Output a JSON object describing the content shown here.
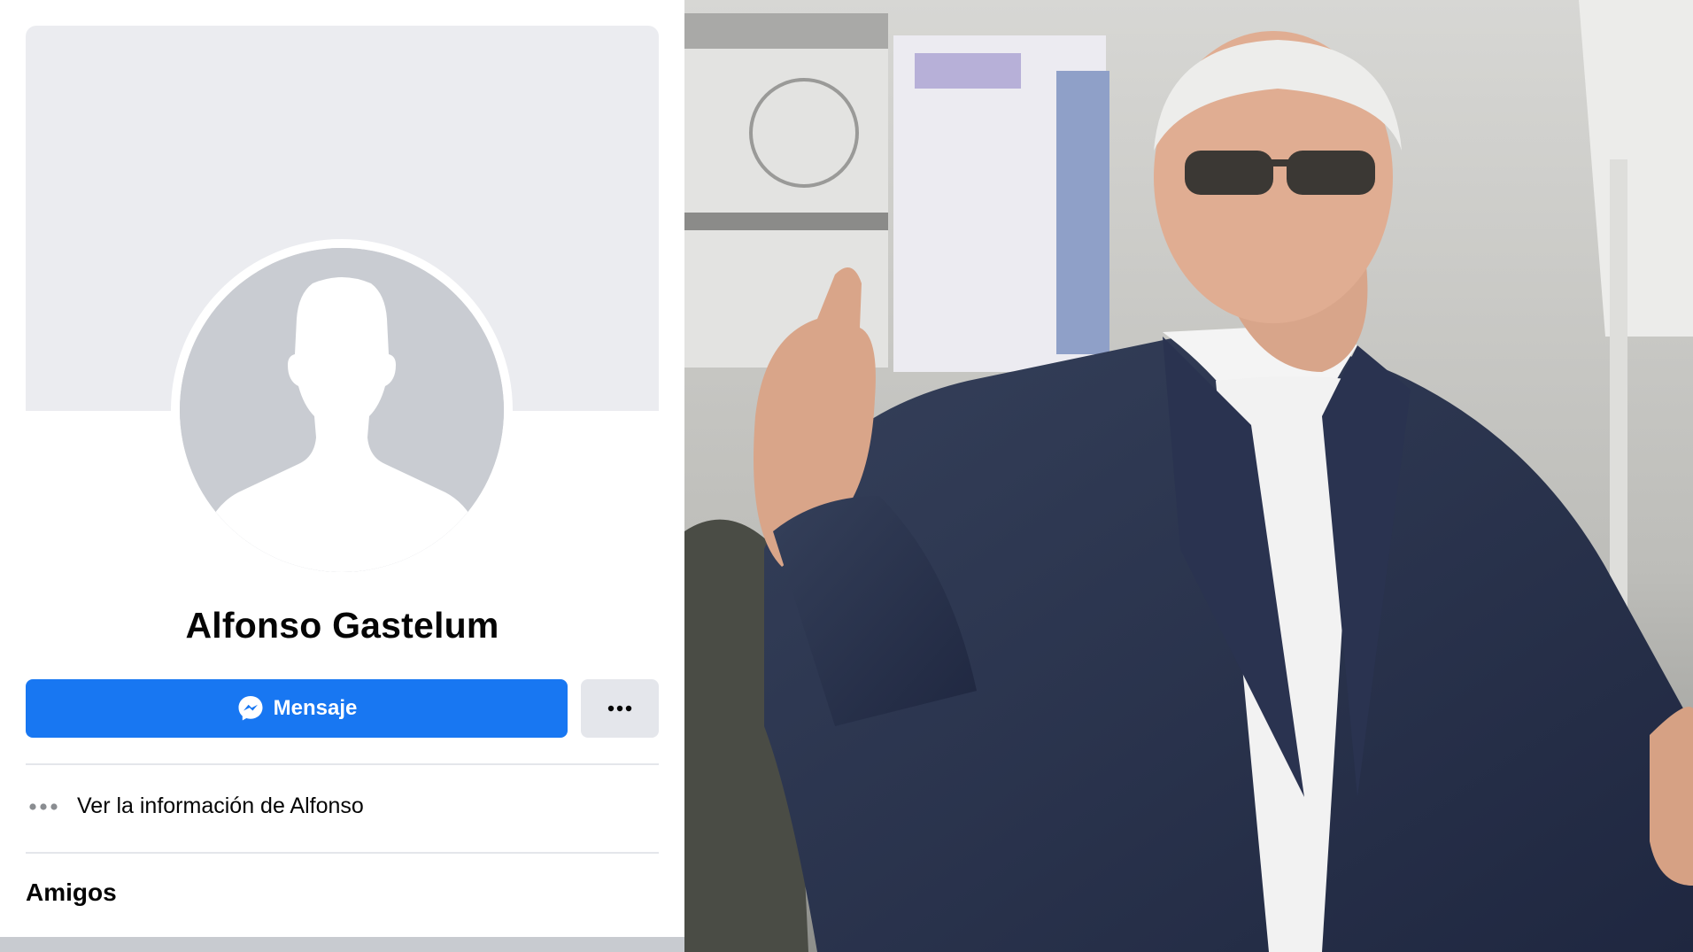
{
  "profile": {
    "name": "Alfonso Gastelum",
    "message_button_label": "Mensaje",
    "info_link_label": "Ver la información de Alfonso",
    "friends_heading": "Amigos"
  },
  "icons": {
    "messenger": "messenger-icon",
    "more": "more-dots-icon",
    "info": "more-dots-icon",
    "avatar": "default-avatar-silhouette"
  },
  "colors": {
    "brand_blue": "#1877f2",
    "secondary_button": "#e4e6eb",
    "cover_gray": "#ebecf0",
    "avatar_gray": "#c9ccd2",
    "text_primary": "#050505"
  }
}
